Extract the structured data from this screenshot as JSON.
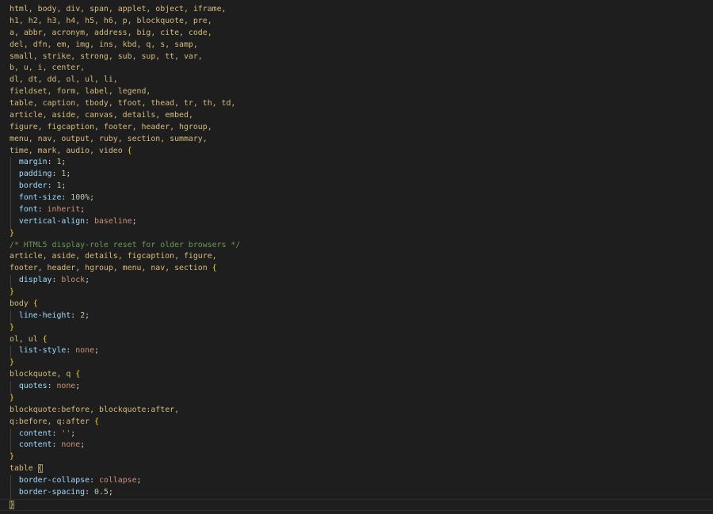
{
  "editor": {
    "theme_colors": {
      "background": "#1e1e1e",
      "selector": "#d7ba7d",
      "property": "#9cdcfe",
      "number": "#b5cea8",
      "value": "#ce9178",
      "comment": "#6a9955",
      "brace": "#ffd700"
    },
    "lines": [
      [
        [
          "sel",
          "html, body, div, span, applet, object, iframe,"
        ]
      ],
      [
        [
          "sel",
          "h1, h2, h3, h4, h5, h6, p, blockquote, pre,"
        ]
      ],
      [
        [
          "sel",
          "a, abbr, acronym, address, big, cite, code,"
        ]
      ],
      [
        [
          "sel",
          "del, dfn, em, img, ins, kbd, q, s, samp,"
        ]
      ],
      [
        [
          "sel",
          "small, strike, strong, sub, sup, tt, var,"
        ]
      ],
      [
        [
          "sel",
          "b, u, i, center,"
        ]
      ],
      [
        [
          "sel",
          "dl, dt, dd, ol, ul, li,"
        ]
      ],
      [
        [
          "sel",
          "fieldset, form, label, legend,"
        ]
      ],
      [
        [
          "sel",
          "table, caption, tbody, tfoot, thead, tr, th, td,"
        ]
      ],
      [
        [
          "sel",
          "article, aside, canvas, details, embed,"
        ]
      ],
      [
        [
          "sel",
          "figure, figcaption, footer, header, hgroup,"
        ]
      ],
      [
        [
          "sel",
          "menu, nav, output, ruby, section, summary,"
        ]
      ],
      [
        [
          "sel",
          "time, mark, audio, video "
        ],
        [
          "brace",
          "{"
        ]
      ],
      [
        [
          "punc",
          "  "
        ],
        [
          "prop",
          "margin"
        ],
        [
          "punc",
          ": "
        ],
        [
          "num",
          "1"
        ],
        [
          "punc",
          ";"
        ]
      ],
      [
        [
          "punc",
          "  "
        ],
        [
          "prop",
          "padding"
        ],
        [
          "punc",
          ": "
        ],
        [
          "num",
          "1"
        ],
        [
          "punc",
          ";"
        ]
      ],
      [
        [
          "punc",
          "  "
        ],
        [
          "prop",
          "border"
        ],
        [
          "punc",
          ": "
        ],
        [
          "num",
          "1"
        ],
        [
          "punc",
          ";"
        ]
      ],
      [
        [
          "punc",
          "  "
        ],
        [
          "prop",
          "font-size"
        ],
        [
          "punc",
          ": "
        ],
        [
          "num",
          "100%"
        ],
        [
          "punc",
          ";"
        ]
      ],
      [
        [
          "punc",
          "  "
        ],
        [
          "prop",
          "font"
        ],
        [
          "punc",
          ": "
        ],
        [
          "val",
          "inherit"
        ],
        [
          "punc",
          ";"
        ]
      ],
      [
        [
          "punc",
          "  "
        ],
        [
          "prop",
          "vertical-align"
        ],
        [
          "punc",
          ": "
        ],
        [
          "val",
          "baseline"
        ],
        [
          "punc",
          ";"
        ]
      ],
      [
        [
          "brace",
          "}"
        ]
      ],
      [
        [
          "com",
          "/* HTML5 display-role reset for older browsers */"
        ]
      ],
      [
        [
          "sel",
          "article, aside, details, figcaption, figure,"
        ]
      ],
      [
        [
          "sel",
          "footer, header, hgroup, menu, nav, section "
        ],
        [
          "brace",
          "{"
        ]
      ],
      [
        [
          "punc",
          "  "
        ],
        [
          "prop",
          "display"
        ],
        [
          "punc",
          ": "
        ],
        [
          "val",
          "block"
        ],
        [
          "punc",
          ";"
        ]
      ],
      [
        [
          "brace",
          "}"
        ]
      ],
      [
        [
          "sel",
          "body "
        ],
        [
          "brace",
          "{"
        ]
      ],
      [
        [
          "punc",
          "  "
        ],
        [
          "prop",
          "line-height"
        ],
        [
          "punc",
          ": "
        ],
        [
          "num",
          "2"
        ],
        [
          "punc",
          ";"
        ]
      ],
      [
        [
          "brace",
          "}"
        ]
      ],
      [
        [
          "sel",
          "ol, ul "
        ],
        [
          "brace",
          "{"
        ]
      ],
      [
        [
          "punc",
          "  "
        ],
        [
          "prop",
          "list-style"
        ],
        [
          "punc",
          ": "
        ],
        [
          "val",
          "none"
        ],
        [
          "punc",
          ";"
        ]
      ],
      [
        [
          "brace",
          "}"
        ]
      ],
      [
        [
          "sel",
          "blockquote, q "
        ],
        [
          "brace",
          "{"
        ]
      ],
      [
        [
          "punc",
          "  "
        ],
        [
          "prop",
          "quotes"
        ],
        [
          "punc",
          ": "
        ],
        [
          "val",
          "none"
        ],
        [
          "punc",
          ";"
        ]
      ],
      [
        [
          "brace",
          "}"
        ]
      ],
      [
        [
          "sel",
          "blockquote:before, blockquote:after,"
        ]
      ],
      [
        [
          "sel",
          "q:before, q:after "
        ],
        [
          "brace",
          "{"
        ]
      ],
      [
        [
          "punc",
          "  "
        ],
        [
          "prop",
          "content"
        ],
        [
          "punc",
          ": "
        ],
        [
          "val",
          "''"
        ],
        [
          "punc",
          ";"
        ]
      ],
      [
        [
          "punc",
          "  "
        ],
        [
          "prop",
          "content"
        ],
        [
          "punc",
          ": "
        ],
        [
          "val",
          "none"
        ],
        [
          "punc",
          ";"
        ]
      ],
      [
        [
          "brace",
          "}"
        ]
      ],
      [
        [
          "sel",
          "table "
        ],
        [
          "brace",
          "{"
        ]
      ],
      [
        [
          "punc",
          "  "
        ],
        [
          "prop",
          "border-collapse"
        ],
        [
          "punc",
          ": "
        ],
        [
          "val",
          "collapse"
        ],
        [
          "punc",
          ";"
        ]
      ],
      [
        [
          "punc",
          "  "
        ],
        [
          "prop",
          "border-spacing"
        ],
        [
          "punc",
          ": "
        ],
        [
          "num",
          "0.5"
        ],
        [
          "punc",
          ";"
        ]
      ],
      [
        [
          "brace",
          "}"
        ]
      ]
    ]
  }
}
